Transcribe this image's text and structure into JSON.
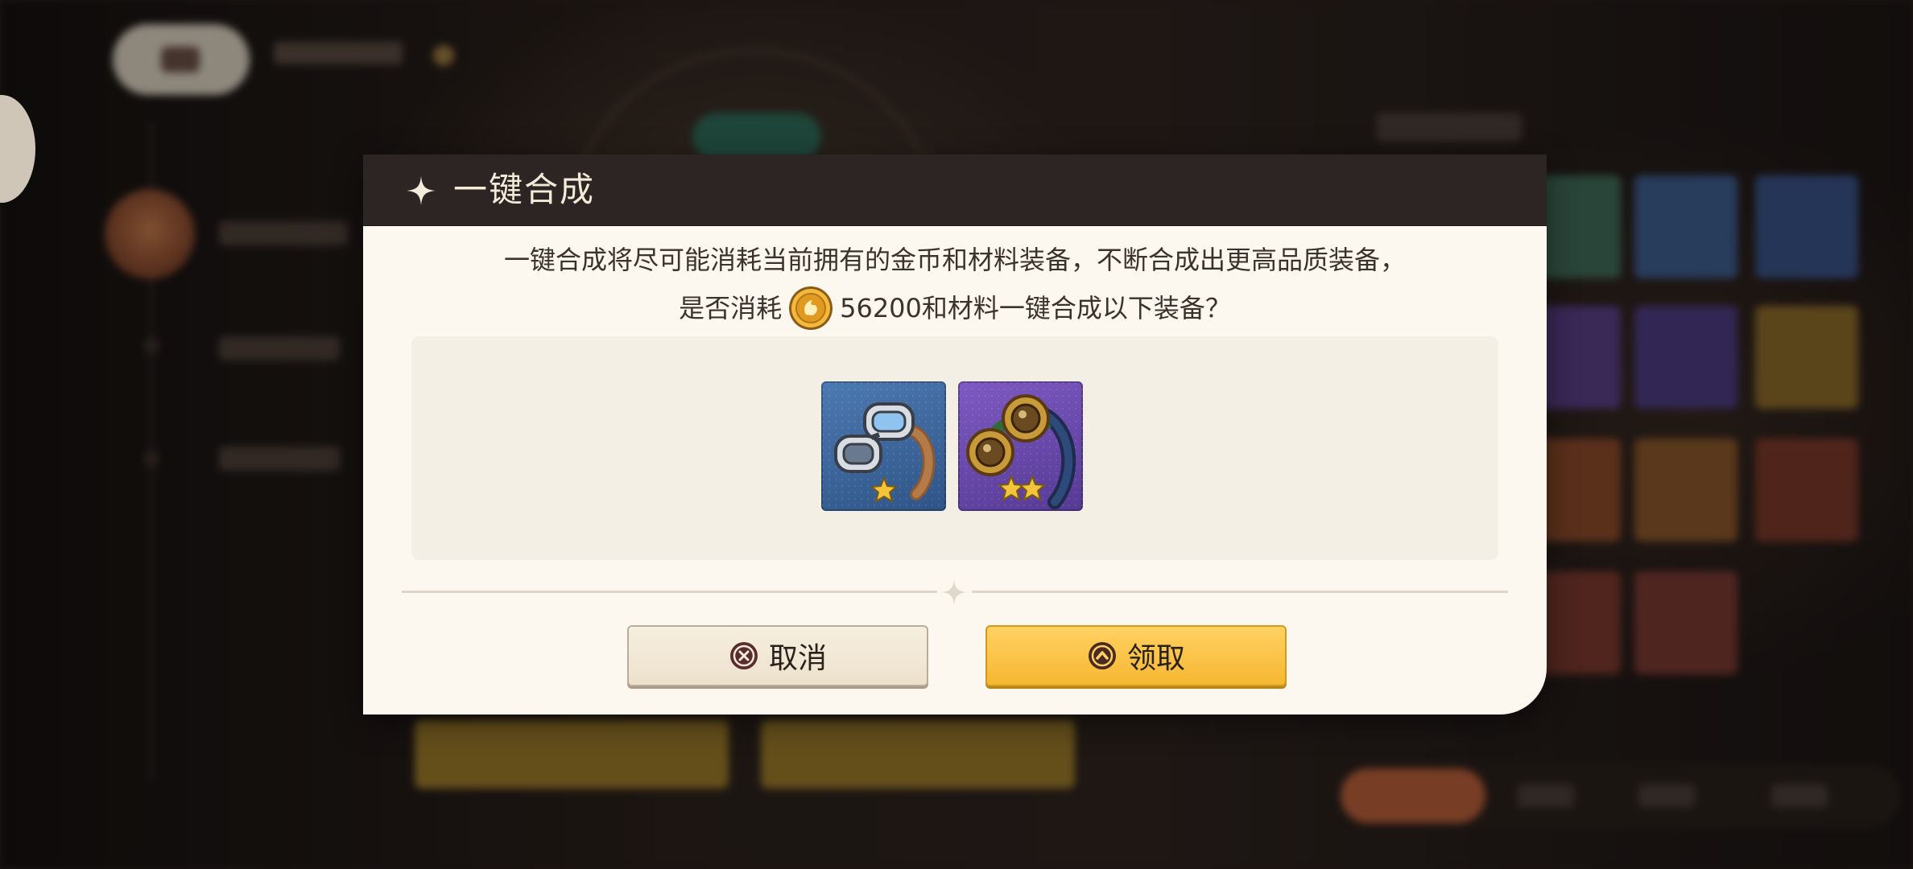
{
  "dialog": {
    "title": "一键合成",
    "message_line1": "一键合成将尽可能消耗当前拥有的金币和材料装备，不断合成出更高品质装备，",
    "message_line2_prefix": "是否消耗",
    "coin_amount": "56200",
    "message_line2_suffix": "和材料一键合成以下装备？",
    "items": [
      {
        "name": "goggles",
        "rarity_stars": 1,
        "background": "#3f6aa1"
      },
      {
        "name": "goggles",
        "rarity_stars": 2,
        "background": "#6a4aaa"
      }
    ],
    "buttons": {
      "cancel_label": "取消",
      "confirm_label": "领取"
    }
  },
  "colors": {
    "header_bg": "#2c2524",
    "dialog_bg": "#fcf8ef",
    "confirm_button": "#ffc94a",
    "cancel_button": "#f3eadb",
    "star": "#f2c53d"
  },
  "icons": {
    "header": "sparkle-icon",
    "currency": "gold-coin-icon",
    "cancel": "x-circle-icon",
    "confirm": "up-chevron-circle-icon"
  }
}
